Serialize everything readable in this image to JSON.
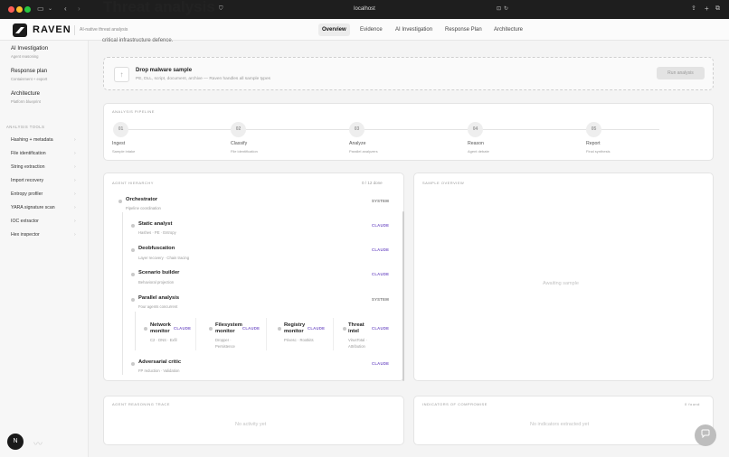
{
  "browser": {
    "url": "localhost",
    "ghost_title": "Threat analysis"
  },
  "app": {
    "logo": "RAVEN",
    "tagline": "AI-native threat analysis",
    "nav": [
      "Overview",
      "Evidence",
      "AI Investigation",
      "Response Plan",
      "Architecture"
    ],
    "active_nav": "Overview"
  },
  "sidebar": {
    "items": [
      {
        "label": "AI Investigation",
        "sub": "Agent reasoning"
      },
      {
        "label": "Response plan",
        "sub": "Containment + export"
      },
      {
        "label": "Architecture",
        "sub": "Platform blueprint"
      }
    ],
    "tools_heading": "ANALYSIS TOOLS",
    "tools": [
      "Hashing + metadata",
      "File identification",
      "String extraction",
      "Import recovery",
      "Entropy profiler",
      "YARA signature scan",
      "IOC extractor",
      "Hex inspector"
    ],
    "avatar": "N"
  },
  "main": {
    "cut_text": "critical infrastructure defence.",
    "dropzone": {
      "title": "Drop malware sample",
      "subtitle": "PE, DLL, script, document, archive — Raven handles all sample types",
      "button": "Run analysis"
    },
    "pipeline": {
      "heading": "ANALYSIS PIPELINE",
      "steps": [
        {
          "num": "01",
          "name": "Ingest",
          "desc": "Sample intake"
        },
        {
          "num": "02",
          "name": "Classify",
          "desc": "File identification"
        },
        {
          "num": "03",
          "name": "Analyze",
          "desc": "Parallel analyzers"
        },
        {
          "num": "04",
          "name": "Reason",
          "desc": "Agent debate"
        },
        {
          "num": "05",
          "name": "Report",
          "desc": "Final synthesis"
        }
      ]
    },
    "hierarchy": {
      "heading": "AGENT HIERARCHY",
      "done": "0",
      "slash": "/",
      "total": "12",
      "done_label": "done",
      "root": {
        "name": "Orchestrator",
        "desc": "Pipeline coordination",
        "tag": "SYSTEM"
      },
      "agents": [
        {
          "name": "Static analyst",
          "desc": "Hashes · PE · Entropy",
          "tag": "CLAUDE"
        },
        {
          "name": "Deobfuscation",
          "desc": "Layer recovery · Chain tracing",
          "tag": "CLAUDE"
        },
        {
          "name": "Scenario builder",
          "desc": "Behavioral projection",
          "tag": "CLAUDE"
        },
        {
          "name": "Parallel analysis",
          "desc": "Four agents concurrent",
          "tag": "SYSTEM"
        },
        {
          "name": "Adversarial critic",
          "desc": "FP reduction · Validation",
          "tag": "CLAUDE"
        }
      ],
      "parallel": [
        {
          "name1": "Network",
          "name2": "monitor",
          "desc1": "C2 · DNS · Exfil",
          "desc2": "",
          "tag": "CLAUDE"
        },
        {
          "name1": "Filesystem",
          "name2": "monitor",
          "desc1": "Dropper ·",
          "desc2": "Persistence",
          "tag": "CLAUDE"
        },
        {
          "name1": "Registry",
          "name2": "monitor",
          "desc1": "Privesc · Rootkits",
          "desc2": "",
          "tag": "CLAUDE"
        },
        {
          "name1": "Threat",
          "name2": "intel",
          "desc1": "VirusTotal ·",
          "desc2": "Attribution",
          "tag": "CLAUDE"
        }
      ]
    },
    "overview": {
      "heading": "SAMPLE OVERVIEW",
      "empty": "Awaiting sample"
    },
    "trace": {
      "heading": "AGENT REASONING TRACE",
      "empty": "No activity yet"
    },
    "ioc": {
      "heading": "INDICATORS OF COMPROMISE",
      "count": "0",
      "count_label": "found",
      "empty": "No indicators extracted yet"
    }
  },
  "colors": {
    "claude_tag": "#7a5bc9",
    "close": "#ff5f57",
    "minimize": "#febc2e",
    "zoom": "#28c840"
  },
  "icons": [
    "sidebar-toggle-icon",
    "back-icon",
    "forward-icon",
    "shield-icon",
    "refresh-icon",
    "share-icon",
    "new-tab-icon",
    "tabs-icon",
    "upload-icon",
    "chevron-right-icon",
    "chat-icon"
  ]
}
